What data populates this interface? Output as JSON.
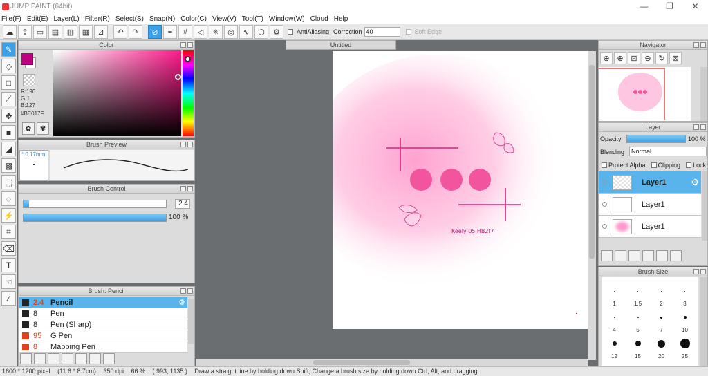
{
  "window": {
    "title": "JUMP PAINT (64bit)",
    "minimize": "—",
    "maximize": "❐",
    "close": "✕"
  },
  "menu": [
    "File(F)",
    "Edit(E)",
    "Layer(L)",
    "Filter(R)",
    "Select(S)",
    "Snap(N)",
    "Color(C)",
    "View(V)",
    "Tool(T)",
    "Window(W)",
    "Cloud",
    "Help"
  ],
  "toolbar": {
    "antialiasing_label": "AntiAliasing",
    "correction_label": "Correction",
    "correction_value": "40",
    "soft_edge_label": "Soft Edge"
  },
  "color_panel": {
    "title": "Color",
    "r": "R:190",
    "g": "G:1",
    "b": "B:127",
    "hex": "#BE017F",
    "fg_color": "#BE017F"
  },
  "brush_preview": {
    "title": "Brush Preview",
    "size": "* 0.17mm"
  },
  "brush_control": {
    "title": "Brush Control",
    "size_value": "2.4",
    "size_fraction": 0.04,
    "opacity_value": "100 %",
    "opacity_fraction": 1.0
  },
  "brush_list": {
    "title": "Brush: Pencil",
    "items": [
      {
        "size": "2.4",
        "name": "Pencil",
        "selected": true,
        "color": "#222222"
      },
      {
        "size": "8",
        "name": "Pen",
        "selected": false,
        "color": "#222222"
      },
      {
        "size": "8",
        "name": "Pen (Sharp)",
        "selected": false,
        "color": "#222222"
      },
      {
        "size": "95",
        "name": "G Pen",
        "selected": false,
        "color": "#e04020"
      },
      {
        "size": "8",
        "name": "Mapping Pen",
        "selected": false,
        "color": "#e04020"
      }
    ]
  },
  "canvas": {
    "tab_title": "Untitled",
    "signature": "Keely 05 HB2f7"
  },
  "navigator": {
    "title": "Navigator"
  },
  "layer_panel": {
    "title": "Layer",
    "opacity_label": "Opacity",
    "opacity_value": "100 %",
    "opacity_fraction": 1.0,
    "blending_label": "Blending",
    "blending_value": "Normal",
    "protect_alpha": "Protect Alpha",
    "clipping": "Clipping",
    "lock": "Lock",
    "layers": [
      {
        "name": "Layer1",
        "selected": true
      },
      {
        "name": "Layer1",
        "selected": false
      },
      {
        "name": "Layer1",
        "selected": false
      }
    ]
  },
  "brush_size_panel": {
    "title": "Brush Size",
    "sizes": [
      "1",
      "1.5",
      "2",
      "3",
      "4",
      "5",
      "7",
      "10",
      "12",
      "15",
      "20",
      "25"
    ]
  },
  "status": {
    "pixels": "1600 * 1200 pixel",
    "physical": "(11.6 * 8.7cm)",
    "dpi": "350 dpi",
    "zoom": "66 %",
    "coords": "( 993, 1135 )",
    "hint": "Draw a straight line by holding down Shift, Change a brush size by holding down Ctrl, Alt, and dragging"
  },
  "colors": {
    "accent": "#3aa0e8",
    "pink": "#ff5aa8",
    "selection": "#58b4ea"
  }
}
